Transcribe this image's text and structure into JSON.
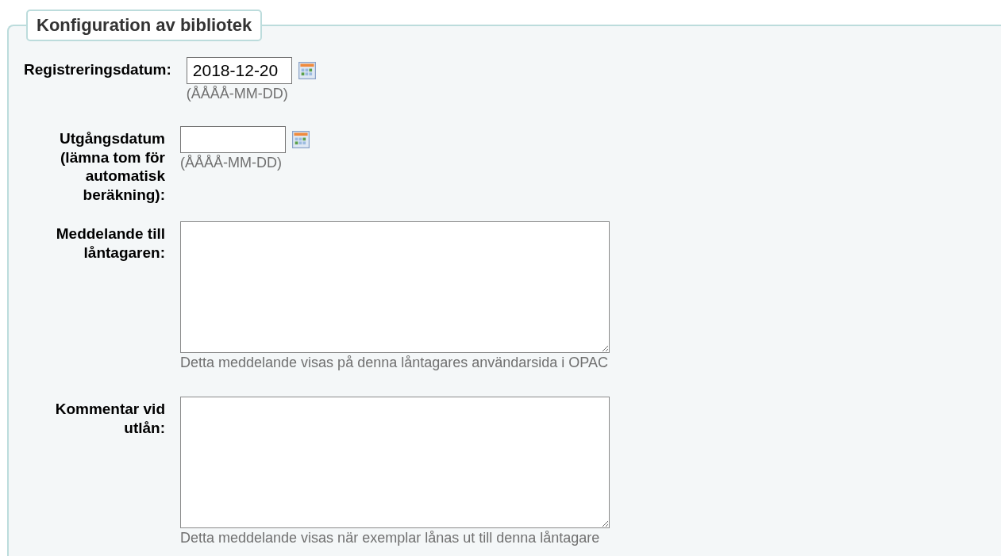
{
  "legend": "Konfiguration av bibliotek",
  "fields": [
    {
      "kind": "date",
      "label": "Registreringsdatum:",
      "value": "2018-12-20",
      "hint": "(ÅÅÅÅ-MM-DD)"
    },
    {
      "kind": "date",
      "label": "Utgångsdatum (lämna tom för automatisk beräkning):",
      "hint": "(ÅÅÅÅ-MM-DD)"
    },
    {
      "kind": "textarea",
      "label": "Meddelande till låntagaren:",
      "hint": "Detta meddelande visas på denna låntagares användarsida i OPAC"
    },
    {
      "kind": "textarea",
      "label": "Kommentar vid utlån:",
      "hint": "Detta meddelande visas när exemplar lånas ut till denna låntagare"
    }
  ]
}
